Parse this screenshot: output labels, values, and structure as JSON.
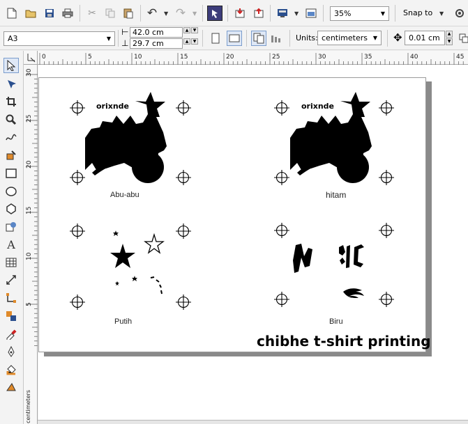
{
  "toolbar1": {
    "zoom_value": "35%",
    "snap_label": "Snap to"
  },
  "toolbar2": {
    "paper_size": "A3",
    "width_value": "42.0 cm",
    "height_value": "29.7 cm",
    "units_label": "Units:",
    "units_value": "centimeters",
    "nudge_value": "0.01 cm"
  },
  "rulers": {
    "horizontal_ticks": [
      "0",
      "5",
      "10",
      "15",
      "20",
      "25",
      "30",
      "35",
      "40",
      "45"
    ],
    "vertical_ticks": [
      "30",
      "25",
      "20",
      "15",
      "10",
      "5"
    ],
    "vertical_unit_label": "centimeters"
  },
  "designs": {
    "top_left_label": "Abu-abu",
    "top_right_label": "hitam",
    "bottom_left_label": "Putih",
    "bottom_right_label": "Biru",
    "logo_text": "orixnde"
  },
  "watermark": "chibhe t-shirt printing",
  "icons": {
    "new": "new-document-icon",
    "open": "open-folder-icon",
    "save": "save-icon",
    "print": "print-icon",
    "cut": "cut-icon",
    "copy": "copy-icon",
    "paste": "paste-icon",
    "undo": "undo-icon",
    "redo": "redo-icon",
    "launcher": "application-launcher-icon",
    "import": "import-icon",
    "export": "export-icon",
    "fullscreen": "full-screen-preview-icon"
  }
}
